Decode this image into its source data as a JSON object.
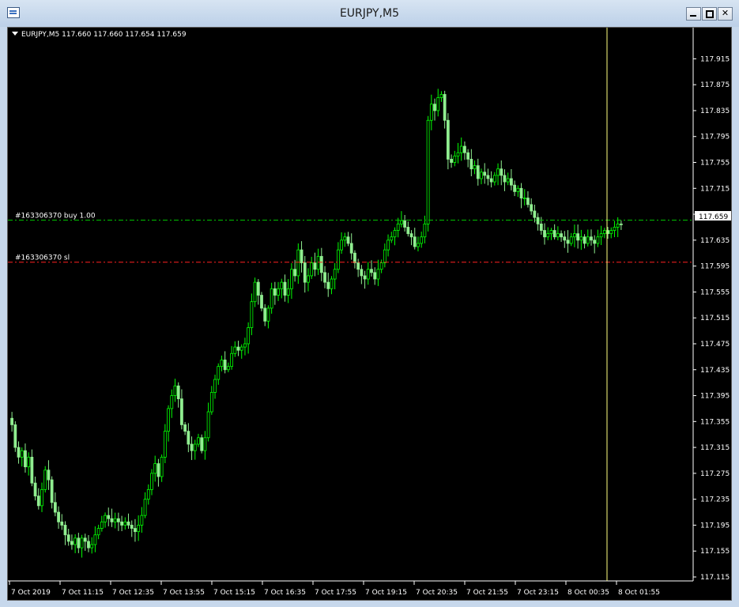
{
  "window": {
    "title": "EURJPY,M5",
    "buttons": {
      "minimize": "minimize",
      "maximize": "maximize",
      "close": "close"
    }
  },
  "chart_data": {
    "type": "candlestick",
    "symbol_info": "EURJPY,M5  117.660 117.660 117.654 117.659",
    "colors": {
      "background": "#000000",
      "bull": "#00ff00",
      "bear": "#90ee90",
      "buy_line": "#00c000",
      "sl_line": "#ff2020",
      "cursor_line": "#ffff80",
      "axis_text": "#ffffff"
    },
    "ylim": [
      117.115,
      117.935
    ],
    "y_ticks": [
      "117.915",
      "117.875",
      "117.835",
      "117.795",
      "117.755",
      "117.715",
      "117.675",
      "117.635",
      "117.595",
      "117.555",
      "117.515",
      "117.475",
      "117.435",
      "117.395",
      "117.355",
      "117.315",
      "117.275",
      "117.235",
      "117.195",
      "117.155",
      "117.115"
    ],
    "x_ticks": [
      "7 Oct 2019",
      "7 Oct 11:15",
      "7 Oct 12:35",
      "7 Oct 13:55",
      "7 Oct 15:15",
      "7 Oct 16:35",
      "7 Oct 17:55",
      "7 Oct 19:15",
      "7 Oct 20:35",
      "7 Oct 21:55",
      "7 Oct 23:15",
      "8 Oct 00:35",
      "8 Oct 01:55"
    ],
    "current_price": "117.659",
    "orders": [
      {
        "label": "#163306370 buy 1.00",
        "price": 117.666,
        "kind": "buy"
      },
      {
        "label": "#163306370 sl",
        "price": 117.601,
        "kind": "sl"
      }
    ],
    "closes": [
      117.35,
      117.315,
      117.3,
      117.31,
      117.285,
      117.3,
      117.26,
      117.24,
      117.225,
      117.25,
      117.28,
      117.265,
      117.23,
      117.215,
      117.2,
      117.195,
      117.18,
      117.17,
      117.165,
      117.175,
      117.16,
      117.175,
      117.17,
      117.16,
      117.165,
      117.18,
      117.19,
      117.2,
      117.21,
      117.205,
      117.2,
      117.205,
      117.2,
      117.195,
      117.2,
      117.195,
      117.19,
      117.185,
      117.195,
      117.21,
      117.235,
      117.25,
      117.275,
      117.29,
      117.27,
      117.3,
      117.34,
      117.375,
      117.395,
      117.41,
      117.39,
      117.35,
      117.34,
      117.32,
      117.31,
      117.32,
      117.33,
      117.31,
      117.33,
      117.37,
      117.4,
      117.42,
      117.44,
      117.45,
      117.435,
      117.44,
      117.46,
      117.47,
      117.465,
      117.47,
      117.475,
      117.5,
      117.54,
      117.57,
      117.55,
      117.53,
      117.51,
      117.53,
      117.56,
      117.55,
      117.56,
      117.57,
      117.55,
      117.56,
      117.59,
      117.58,
      117.62,
      117.6,
      117.57,
      117.58,
      117.6,
      117.59,
      117.61,
      117.585,
      117.57,
      117.56,
      117.575,
      117.59,
      117.62,
      117.635,
      117.64,
      117.63,
      117.615,
      117.6,
      117.59,
      117.58,
      117.575,
      117.59,
      117.585,
      117.575,
      117.59,
      117.6,
      117.62,
      117.635,
      117.64,
      117.65,
      117.66,
      117.665,
      117.655,
      117.645,
      117.64,
      117.625,
      117.63,
      117.64,
      117.66,
      117.82,
      117.845,
      117.835,
      117.855,
      117.86,
      117.82,
      117.76,
      117.755,
      117.765,
      117.77,
      117.78,
      117.77,
      117.76,
      117.745,
      117.75,
      117.73,
      117.74,
      117.735,
      117.73,
      117.725,
      117.735,
      117.745,
      117.735,
      117.725,
      117.73,
      117.72,
      117.71,
      117.715,
      117.7,
      117.7,
      117.69,
      117.68,
      117.67,
      117.66,
      117.65,
      117.64,
      117.645,
      117.65,
      117.64,
      117.645,
      117.64,
      117.635,
      117.63,
      117.64,
      117.645,
      117.635,
      117.64,
      117.63,
      117.64,
      117.635,
      117.63,
      117.64,
      117.645,
      117.65,
      117.645,
      117.65,
      117.655,
      117.66,
      117.659
    ],
    "grid": false,
    "cursor_line_x": "8 Oct 01:40"
  }
}
